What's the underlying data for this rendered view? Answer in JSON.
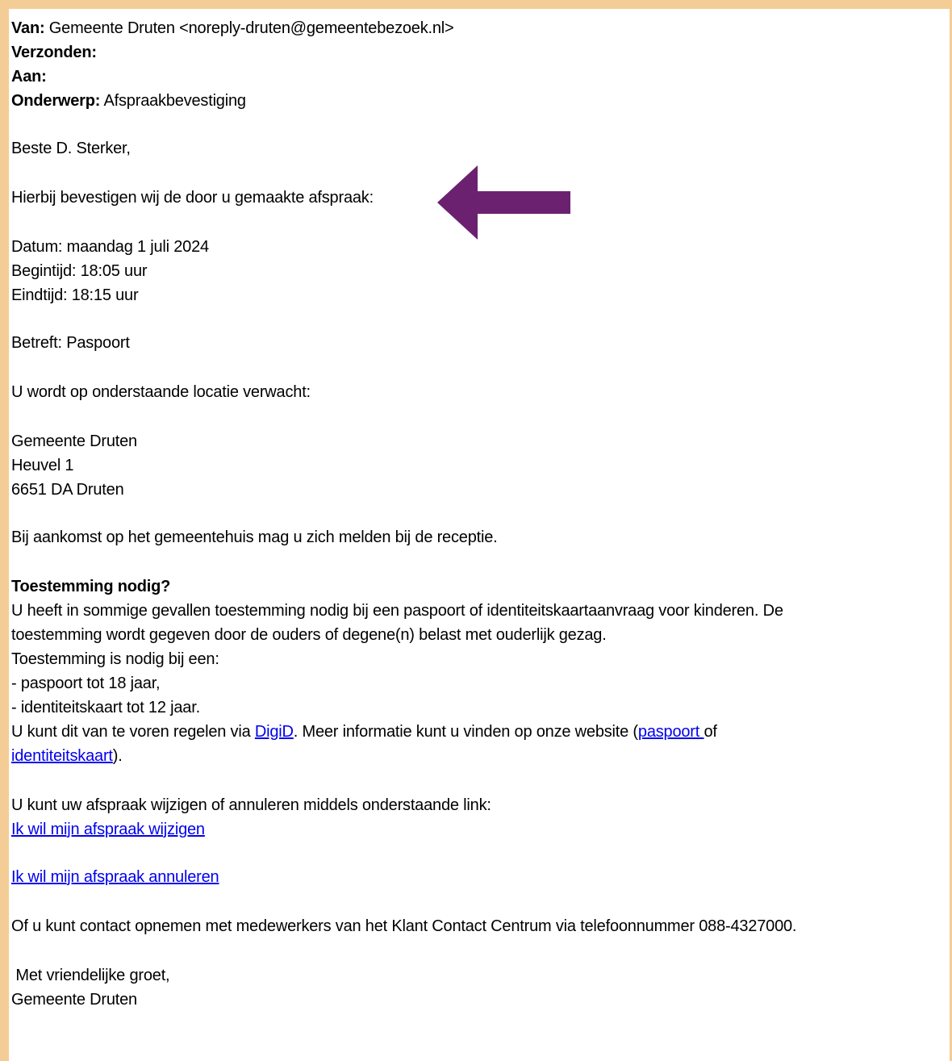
{
  "header": {
    "from_label": "Van:",
    "from_value": "Gemeente Druten <noreply-druten@gemeentebezoek.nl>",
    "sent_label": "Verzonden:",
    "to_label": "Aan:",
    "subject_label": "Onderwerp:",
    "subject_value": "Afspraakbevestiging"
  },
  "body": {
    "greeting": "Beste D. Sterker,",
    "intro": "Hierbij bevestigen wij de door u gemaakte afspraak:",
    "date": "Datum: maandag 1 juli 2024",
    "start_time": "Begintijd: 18:05 uur",
    "end_time": "Eindtijd: 18:15 uur",
    "subject_line": "Betreft: Paspoort",
    "location_intro": "U wordt op onderstaande locatie verwacht:",
    "location": [
      "Gemeente Druten",
      "Heuvel 1",
      "6651 DA  Druten"
    ],
    "arrival": "Bij aankomst op het gemeentehuis mag u zich melden bij de receptie.",
    "consent_heading": "Toestemming nodig?",
    "consent_line1": "U heeft in sommige gevallen toestemming nodig bij een paspoort of identiteitskaartaanvraag  voor kinderen. De",
    "consent_line2": "toestemming wordt gegeven door de ouders of degene(n) belast met ouderlijk gezag.",
    "consent_line3": "Toestemming is nodig bij een:",
    "consent_item1": "- paspoort tot 18 jaar,",
    "consent_item2": "- identiteitskaart tot 12 jaar.",
    "digid_pre": "U kunt dit van te voren regelen via ",
    "digid_link": "DigiD",
    "digid_post": ". Meer informatie kunt u vinden op onze website (",
    "passport_link": "paspoort ",
    "of_text": "of",
    "id_link": "identiteitskaart",
    "id_post": ").",
    "change_intro": "U kunt uw afspraak wijzigen of annuleren middels onderstaande link:",
    "change_link": "Ik wil mijn afspraak wijzigen",
    "cancel_link": "Ik wil mijn afspraak annuleren",
    "contact": "Of u kunt contact opnemen met medewerkers van het Klant Contact Centrum via telefoonnummer 088-4327000.",
    "closing": " Met vriendelijke groet,",
    "signature": "Gemeente Druten"
  },
  "annotation": {
    "arrow_color": "#6b2170",
    "frame_color": "#f3cd95"
  }
}
